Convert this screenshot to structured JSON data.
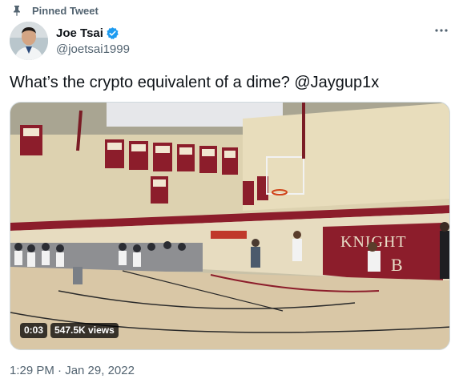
{
  "pinned": {
    "label": "Pinned Tweet",
    "icon": "pin-icon"
  },
  "author": {
    "display_name": "Joe Tsai",
    "handle": "@joetsai1999",
    "verified": true,
    "verified_color": "#1d9bf0"
  },
  "more_icon": "more-horizontal-icon",
  "tweet": {
    "text": "What’s the crypto equivalent of a dime? @Jaygup1x"
  },
  "media": {
    "type": "video",
    "time": "0:03",
    "views": "547.5K views",
    "gym_sign": "KNIGHT",
    "gym_logo": "B"
  },
  "timestamp": "1:29 PM · Jan 29, 2022",
  "colors": {
    "text_primary": "#0f1419",
    "text_secondary": "#536471",
    "accent": "#1d9bf0",
    "gym_wall_red": "#8c1d2b"
  }
}
